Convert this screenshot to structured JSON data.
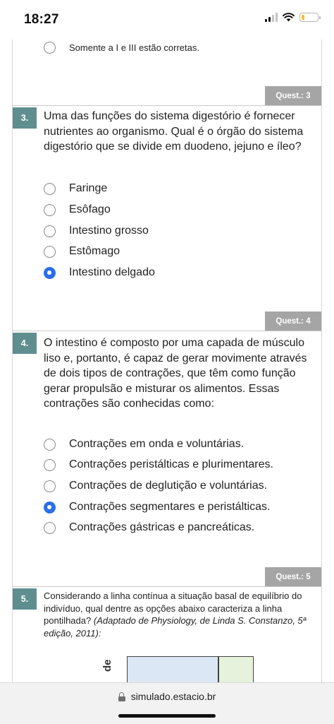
{
  "status_bar": {
    "time": "18:27",
    "battery_level": 0.2,
    "battery_color": "#f2c230",
    "icons": [
      "signal-icon",
      "wifi-icon",
      "battery-icon"
    ]
  },
  "colors": {
    "question_number_bg": "#5f8e8f",
    "quest_badge_bg": "#a5a5a5",
    "selected_radio": "#2b6ee8"
  },
  "previous_question": {
    "last_option": {
      "label": "Somente a I e III estão corretas.",
      "selected": false
    }
  },
  "questions": [
    {
      "badge": "Quest.: 3",
      "number": "3.",
      "text": "Uma das funções do sistema digestório é fornecer nutrientes ao organismo. Qual é o órgão do sistema digestório que se divide em duodeno, jejuno e íleo?",
      "options": [
        {
          "label": "Faringe",
          "selected": false
        },
        {
          "label": "Esôfago",
          "selected": false
        },
        {
          "label": "Intestino grosso",
          "selected": false
        },
        {
          "label": "Estômago",
          "selected": false
        },
        {
          "label": "Intestino delgado",
          "selected": true
        }
      ]
    },
    {
      "badge": "Quest.: 4",
      "number": "4.",
      "text": "O intestino é composto por uma capada de músculo liso e, portanto, é capaz de gerar movimente através de dois tipos de contrações, que têm como função gerar propulsão e misturar os alimentos. Essas contrações são conhecidas como:",
      "options": [
        {
          "label": "Contrações em onda e voluntárias.",
          "selected": false
        },
        {
          "label": "Contrações peristálticas e plurimentares.",
          "selected": false
        },
        {
          "label": "Contrações de deglutição e voluntárias.",
          "selected": false
        },
        {
          "label": "Contrações segmentares e peristálticas.",
          "selected": true
        },
        {
          "label": "Contrações gástricas e pancreáticas.",
          "selected": false
        }
      ]
    },
    {
      "badge": "Quest.: 5",
      "number": "5.",
      "text": "Considerando a linha contínua a situação basal de equilíbrio do indivíduo, qual dentre as opções abaixo caracteriza a linha pontilhada?",
      "source": "(Adaptado de Physiology, de Linda S. Constanzo, 5ª edição, 2011):",
      "figure_axis_label": "de"
    }
  ],
  "browser": {
    "url": "simulado.estacio.br"
  }
}
